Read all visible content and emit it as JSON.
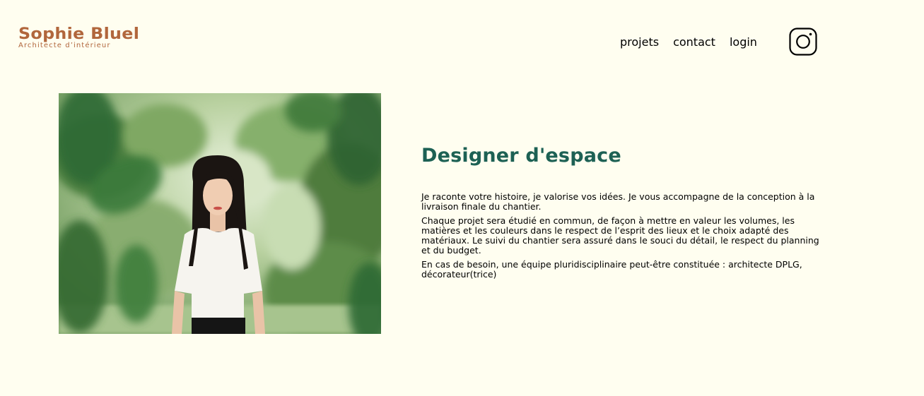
{
  "header": {
    "logo_name": "Sophie Bluel",
    "logo_tagline": "Architecte d’intérieur",
    "nav": [
      {
        "label": "projets"
      },
      {
        "label": "contact"
      },
      {
        "label": "login"
      }
    ],
    "social_icon": "instagram-icon"
  },
  "intro": {
    "photo": "portrait-photo",
    "title": "Designer d'espace",
    "paragraphs": [
      "Je raconte votre histoire, je valorise vos idées. Je vous accompagne de la conception à la livraison finale du chantier.",
      "Chaque projet sera étudié en commun, de façon à mettre en valeur les volumes, les matières et les couleurs dans le respect de l’esprit des lieux et le choix adapté des matériaux. Le suivi du chantier sera assuré dans le souci du détail, le respect du planning et du budget.",
      "En cas de besoin, une équipe pluridisciplinaire peut-être constituée : architecte DPLG, décorateur(trice)"
    ]
  },
  "colors": {
    "background": "#FFFEF0",
    "brand": "#B1663C",
    "heading": "#1D6154"
  }
}
